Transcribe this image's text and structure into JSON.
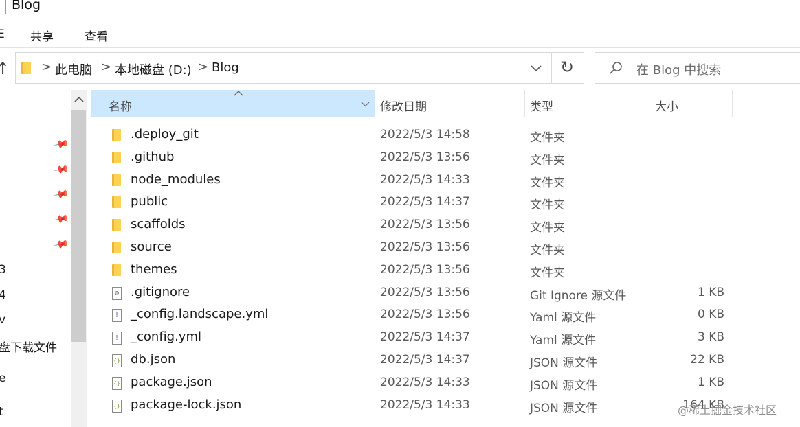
{
  "window": {
    "title": "Blog"
  },
  "ribbon": {
    "tabs": [
      "共享",
      "查看"
    ]
  },
  "address": {
    "breadcrumbs": [
      "此电脑",
      "本地磁盘 (D:)",
      "Blog"
    ],
    "separator": ">"
  },
  "search": {
    "placeholder": "在 Blog 中搜索"
  },
  "nav": {
    "items": [
      "3",
      "4",
      "v",
      "盘下载文件",
      "e",
      "t"
    ]
  },
  "columns": {
    "name": "名称",
    "modified": "修改日期",
    "type": "类型",
    "size": "大小"
  },
  "files": [
    {
      "name": ".deploy_git",
      "modified": "2022/5/3 14:58",
      "type": "文件夹",
      "size": "",
      "icon": "folder-icon"
    },
    {
      "name": ".github",
      "modified": "2022/5/3 13:56",
      "type": "文件夹",
      "size": "",
      "icon": "folder-icon"
    },
    {
      "name": "node_modules",
      "modified": "2022/5/3 14:33",
      "type": "文件夹",
      "size": "",
      "icon": "folder-icon"
    },
    {
      "name": "public",
      "modified": "2022/5/3 14:37",
      "type": "文件夹",
      "size": "",
      "icon": "folder-icon"
    },
    {
      "name": "scaffolds",
      "modified": "2022/5/3 13:56",
      "type": "文件夹",
      "size": "",
      "icon": "folder-icon"
    },
    {
      "name": "source",
      "modified": "2022/5/3 13:56",
      "type": "文件夹",
      "size": "",
      "icon": "folder-icon"
    },
    {
      "name": "themes",
      "modified": "2022/5/3 13:56",
      "type": "文件夹",
      "size": "",
      "icon": "folder-icon"
    },
    {
      "name": ".gitignore",
      "modified": "2022/5/3 13:56",
      "type": "Git Ignore 源文件",
      "size": "1 KB",
      "icon": "gear-file-icon"
    },
    {
      "name": "_config.landscape.yml",
      "modified": "2022/5/3 13:56",
      "type": "Yaml 源文件",
      "size": "0 KB",
      "icon": "yaml-file-icon"
    },
    {
      "name": "_config.yml",
      "modified": "2022/5/3 14:37",
      "type": "Yaml 源文件",
      "size": "3 KB",
      "icon": "yaml-file-icon"
    },
    {
      "name": "db.json",
      "modified": "2022/5/3 14:37",
      "type": "JSON 源文件",
      "size": "22 KB",
      "icon": "json-file-icon"
    },
    {
      "name": "package.json",
      "modified": "2022/5/3 14:33",
      "type": "JSON 源文件",
      "size": "1 KB",
      "icon": "json-file-icon"
    },
    {
      "name": "package-lock.json",
      "modified": "2022/5/3 14:33",
      "type": "JSON 源文件",
      "size": "164 KB",
      "icon": "json-file-icon"
    }
  ],
  "watermark": "@稀土掘金技术社区",
  "colors": {
    "header_selected": "#cce8ff",
    "folder": "#ffd253",
    "folder_dark": "#e8b73a"
  }
}
